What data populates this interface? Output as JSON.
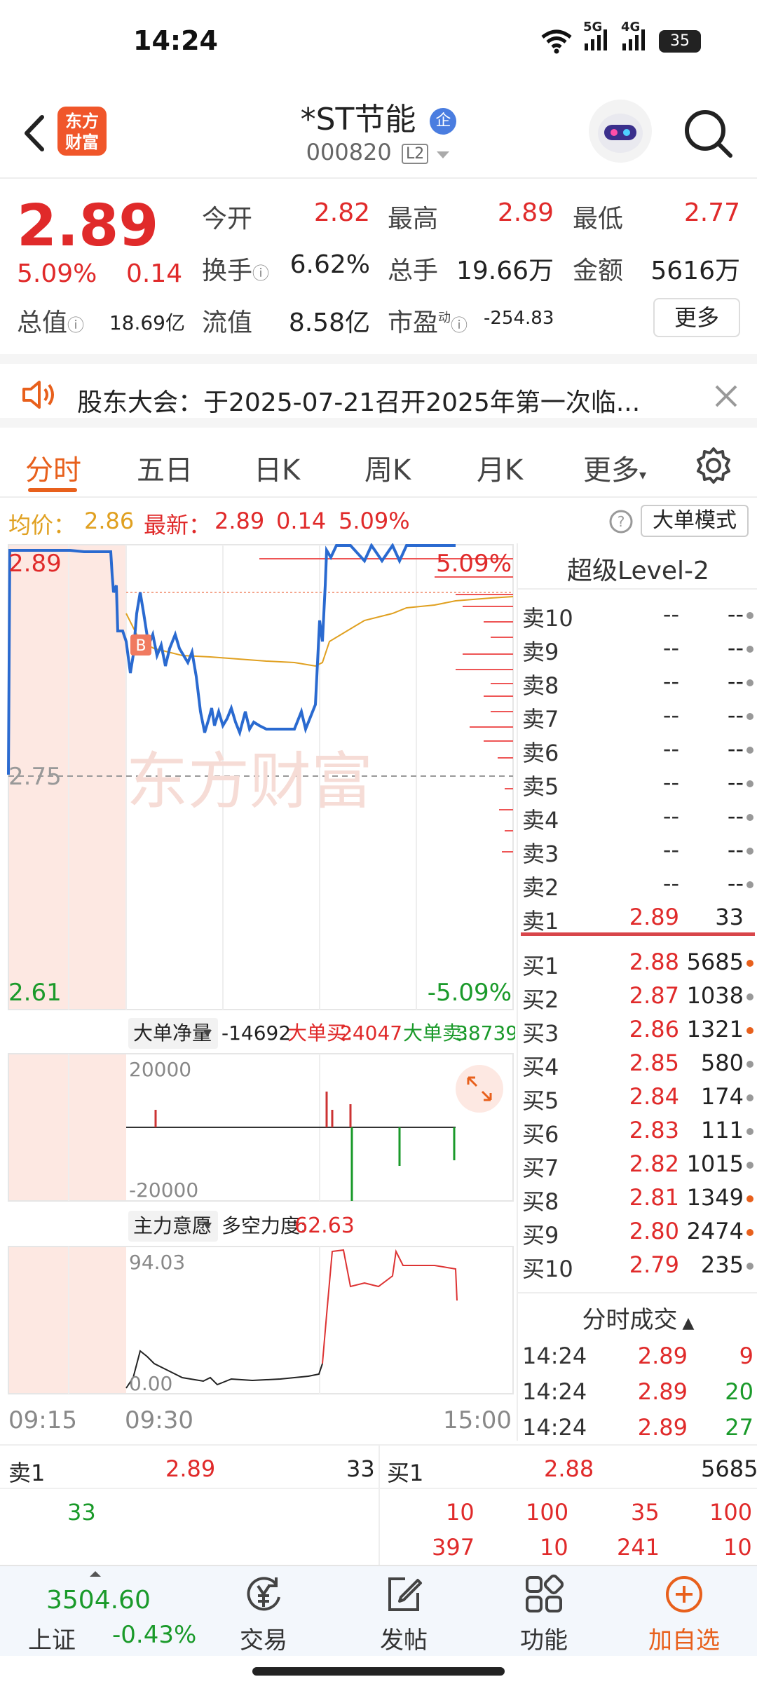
{
  "status": {
    "time": "14:24",
    "battery": "35",
    "net1": "5G",
    "net2": "4G"
  },
  "header": {
    "logo_line1": "东方",
    "logo_line2": "财富",
    "stock_name": "*ST节能",
    "ent_badge": "企",
    "stock_code": "000820",
    "level_tag": "L2"
  },
  "quote": {
    "price": "2.89",
    "pct": "5.09%",
    "change": "0.14",
    "open_label": "今开",
    "open": "2.82",
    "high_label": "最高",
    "high": "2.89",
    "low_label": "最低",
    "low": "2.77",
    "turnover_label": "换手",
    "turnover": "6.62%",
    "volume_label": "总手",
    "volume": "19.66万",
    "amount_label": "金额",
    "amount": "5616万",
    "mktcap_label": "总值",
    "mktcap": "18.69亿",
    "float_label": "流值",
    "float": "8.58亿",
    "pe_label": "市盈",
    "pe_sup": "动",
    "pe": "-254.83",
    "more_label": "更多"
  },
  "notice": {
    "text": "股东大会：于2025-07-21召开2025年第一次临..."
  },
  "tabs": {
    "items": [
      "分时",
      "五日",
      "日K",
      "周K",
      "月K",
      "更多"
    ],
    "active": 0
  },
  "info_row": {
    "avg_label": "均价：",
    "avg": "2.86",
    "latest_label": "最新：",
    "latest": "2.89",
    "chg": "0.14",
    "pct": "5.09%",
    "mode_label": "大单模式"
  },
  "main_chart": {
    "price_top": "2.89",
    "price_mid": "2.75",
    "price_bottom": "2.61",
    "pct_top": "5.09%",
    "pct_bottom": "-5.09%",
    "time_start": "09:15",
    "time_mid": "09:30",
    "time_end": "15:00",
    "b_marker": "B"
  },
  "net_panel": {
    "label": "大单净量",
    "value": "-14692",
    "buy_label": "大单买:",
    "buy": "24047",
    "sell_label": "大单卖:",
    "sell": "38739",
    "ymax": "20000",
    "ymin": "-20000"
  },
  "intent_panel": {
    "label": "主力意愿",
    "force_label": "多空力度:",
    "force": "62.63",
    "ymax": "94.03",
    "ymin": "0.00"
  },
  "orderbook": {
    "title": "超级Level-2",
    "asks": [
      {
        "name": "卖10",
        "price": "--",
        "vol": "--"
      },
      {
        "name": "卖9",
        "price": "--",
        "vol": "--"
      },
      {
        "name": "卖8",
        "price": "--",
        "vol": "--"
      },
      {
        "name": "卖7",
        "price": "--",
        "vol": "--"
      },
      {
        "name": "卖6",
        "price": "--",
        "vol": "--"
      },
      {
        "name": "卖5",
        "price": "--",
        "vol": "--"
      },
      {
        "name": "卖4",
        "price": "--",
        "vol": "--"
      },
      {
        "name": "卖3",
        "price": "--",
        "vol": "--"
      },
      {
        "name": "卖2",
        "price": "--",
        "vol": "--"
      },
      {
        "name": "卖1",
        "price": "2.89",
        "vol": "33"
      }
    ],
    "bids": [
      {
        "name": "买1",
        "price": "2.88",
        "vol": "5685"
      },
      {
        "name": "买2",
        "price": "2.87",
        "vol": "1038"
      },
      {
        "name": "买3",
        "price": "2.86",
        "vol": "1321"
      },
      {
        "name": "买4",
        "price": "2.85",
        "vol": "580"
      },
      {
        "name": "买5",
        "price": "2.84",
        "vol": "174"
      },
      {
        "name": "买6",
        "price": "2.83",
        "vol": "111"
      },
      {
        "name": "买7",
        "price": "2.82",
        "vol": "1015"
      },
      {
        "name": "买8",
        "price": "2.81",
        "vol": "1349"
      },
      {
        "name": "买9",
        "price": "2.80",
        "vol": "2474"
      },
      {
        "name": "买10",
        "price": "2.79",
        "vol": "235"
      }
    ]
  },
  "ticks": {
    "title": "分时成交",
    "rows": [
      {
        "time": "14:24",
        "price": "2.89",
        "vol": "9"
      },
      {
        "time": "14:24",
        "price": "2.89",
        "vol": "20"
      },
      {
        "time": "14:24",
        "price": "2.89",
        "vol": "27"
      }
    ]
  },
  "queue": {
    "ask_label": "卖1",
    "ask_price": "2.89",
    "ask_vol": "33",
    "ask_q": [
      "33"
    ],
    "bid_label": "买1",
    "bid_price": "2.88",
    "bid_vol": "5685",
    "bid_q_row1": [
      "10",
      "100",
      "35",
      "100"
    ],
    "bid_q_row2": [
      "397",
      "10",
      "241",
      "10"
    ]
  },
  "nav": {
    "index_value": "3504.60",
    "index_name": "上证",
    "index_pct": "-0.43%",
    "items": [
      "交易",
      "发帖",
      "功能",
      "加自选"
    ]
  }
}
